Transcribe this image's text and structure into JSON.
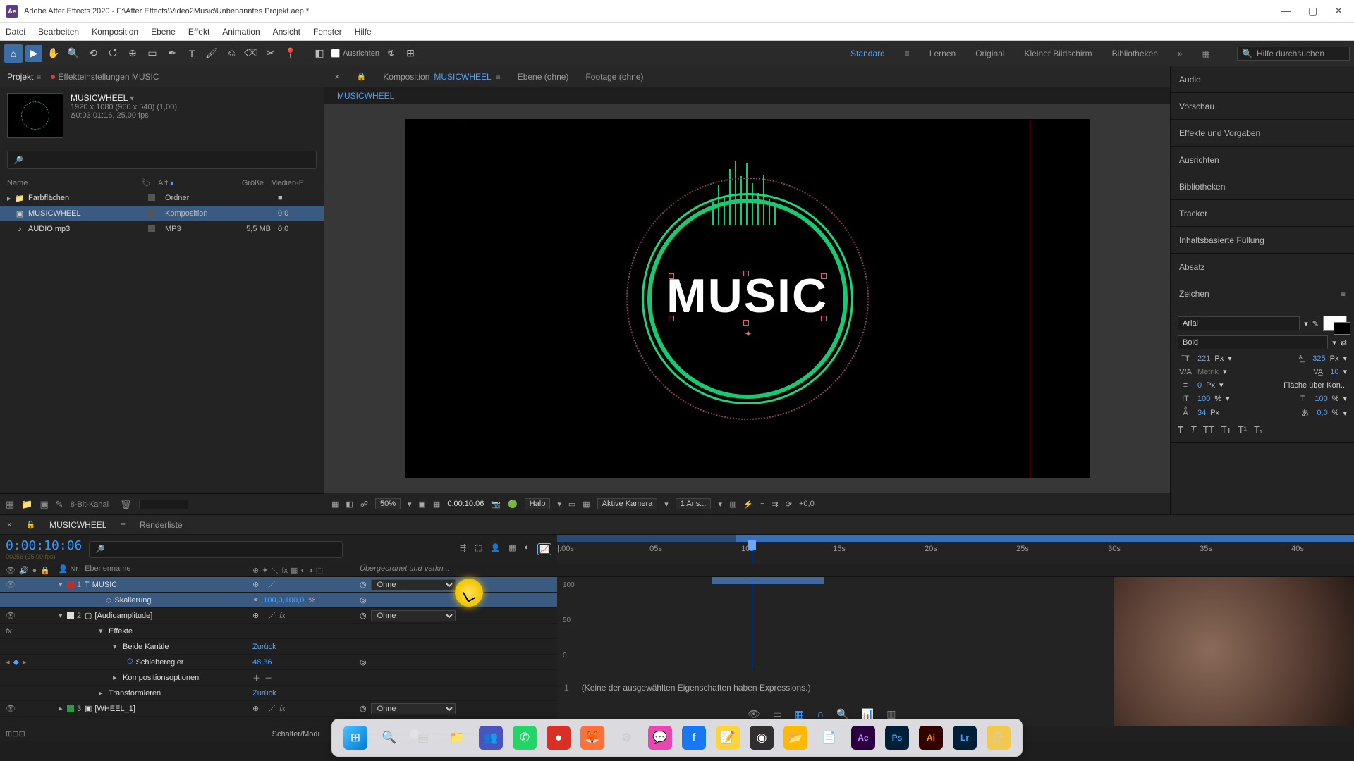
{
  "titlebar": {
    "app_icon_text": "Ae",
    "title": "Adobe After Effects 2020 - F:\\After Effects\\Video2Music\\Unbenanntes Projekt.aep *"
  },
  "menu": [
    "Datei",
    "Bearbeiten",
    "Komposition",
    "Ebene",
    "Effekt",
    "Animation",
    "Ansicht",
    "Fenster",
    "Hilfe"
  ],
  "toolbar": {
    "align_label": "Ausrichten",
    "workspaces": {
      "standard": "Standard",
      "lernen": "Lernen",
      "original": "Original",
      "klein": "Kleiner Bildschirm",
      "bibl": "Bibliotheken"
    },
    "search_placeholder": "Hilfe durchsuchen"
  },
  "project_panel": {
    "tab_project": "Projekt",
    "tab_fx": "Effekteinstellungen MUSIC",
    "selected_name": "MUSICWHEEL",
    "meta1": "1920 x 1080 (960 x 540) (1,00)",
    "meta2": "Δ0:03:01:16, 25,00 fps",
    "cols": {
      "name": "Name",
      "type": "Art",
      "size": "Größe",
      "media": "Medien-E"
    },
    "rows": [
      {
        "icon": "▸",
        "name": "Farbflächen",
        "tag": true,
        "type": "Ordner",
        "size": "",
        "media": "",
        "toggle": "■"
      },
      {
        "icon": "",
        "name": "MUSICWHEEL",
        "tag": true,
        "type": "Komposition",
        "size": "",
        "media": "0:0",
        "sel": true
      },
      {
        "icon": "",
        "name": "AUDIO.mp3",
        "tag": true,
        "type": "MP3",
        "size": "5,5 MB",
        "media": "0:0"
      }
    ],
    "footer_bit": "8-Bit-Kanal"
  },
  "comp": {
    "tab_comp_prefix": "Komposition",
    "tab_comp_name": "MUSICWHEEL",
    "tab_layer": "Ebene (ohne)",
    "tab_footage": "Footage (ohne)",
    "breadcrumb": "MUSICWHEEL",
    "text": "MUSIC",
    "zoom": "50%",
    "time": "0:00:10:06",
    "res": "Halb",
    "camera": "Aktive Kamera",
    "views": "1 Ans...",
    "exposure": "+0,0"
  },
  "right": {
    "audio": "Audio",
    "preview": "Vorschau",
    "presets": "Effekte und Vorgaben",
    "align": "Ausrichten",
    "libs": "Bibliotheken",
    "tracker": "Tracker",
    "content": "Inhaltsbasierte Füllung",
    "para": "Absatz",
    "char": "Zeichen",
    "font": "Arial",
    "weight": "Bold",
    "size": "221",
    "size_unit": "Px",
    "leading": "325",
    "leading_unit": "Px",
    "kerning": "Metrik",
    "tracking": "10",
    "baseline": "0",
    "baseline_unit": "Px",
    "stroke_opt": "Fläche über Kon...",
    "hscale": "100",
    "hscale_unit": "%",
    "vscale": "100",
    "vscale_unit": "%",
    "tsume": "34",
    "tsume_unit": "Px",
    "bshift": "0,0",
    "bshift_unit": "%"
  },
  "timeline": {
    "tab": "MUSICWHEEL",
    "tab2": "Renderliste",
    "timecode": "0:00:10:06",
    "timecode_sub": "00256 (25,00 fps)",
    "cols": {
      "nr": "Nr.",
      "name": "Ebenenname",
      "parent": "Übergeordnet und verkn..."
    },
    "ruler": [
      "|:00s",
      "05s",
      "10s",
      "15s",
      "20s",
      "25s",
      "30s",
      "35s",
      "40s"
    ],
    "expr_none": "(Keine der ausgewählten Eigenschaften haben Expressions.)",
    "rows": {
      "layer1": {
        "nr": "1",
        "name": "MUSIC",
        "parent": "Ohne"
      },
      "skal": {
        "label": "Skalierung",
        "val": "100,0,100,0",
        "unit": "%"
      },
      "layer2": {
        "nr": "2",
        "name": "[Audioamplitude]",
        "parent": "Ohne"
      },
      "effekte": "Effekte",
      "beide": "Beide Kanäle",
      "beide_val": "Zurück",
      "schieb": "Schieberegler",
      "schieb_val": "48,36",
      "kompopt": "Kompositionsoptionen",
      "transf": "Transformieren",
      "transf_val": "Zurück",
      "layer3": {
        "nr": "3",
        "name": "[WHEEL_1]",
        "parent": "Ohne"
      }
    },
    "graph_y": {
      "a": "100",
      "b": "50",
      "c": "0"
    },
    "footer": "Schalter/Modi"
  },
  "taskbar_icons": [
    "win",
    "search",
    "tasks",
    "files",
    "teams",
    "wa",
    "todo",
    "ff",
    "misc",
    "msg",
    "fb",
    "note",
    "obs",
    "folder",
    "np",
    "ae",
    "ps",
    "ai",
    "lr",
    "game"
  ]
}
